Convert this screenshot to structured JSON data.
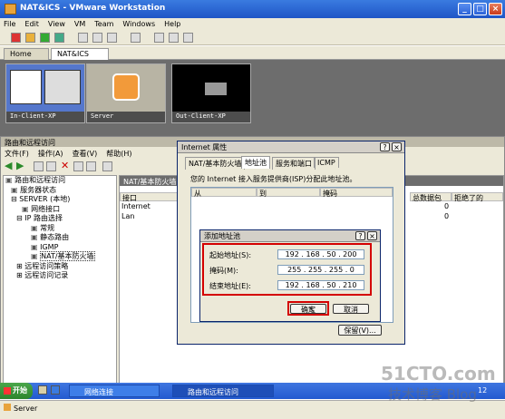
{
  "vmware": {
    "title": "NAT&ICS - VMware Workstation",
    "menu": [
      "File",
      "Edit",
      "View",
      "VM",
      "Team",
      "Windows",
      "Help"
    ],
    "tabs": [
      "Home",
      "NAT&ICS"
    ],
    "thumbs": [
      "In-Client-XP",
      "Server",
      "Out-Client-XP"
    ],
    "status": "Server"
  },
  "rras": {
    "title": "路由和远程访问",
    "menu": [
      "文件(F)",
      "操作(A)",
      "查看(V)",
      "帮助(H)"
    ],
    "tree": [
      "路由和远程访问",
      "服务器状态",
      "SERVER (本地)",
      "网络接口",
      "IP 路由选择",
      "常规",
      "静态路由",
      "IGMP",
      "NAT/基本防火墙",
      "远程访问策略",
      "远程访问记录"
    ],
    "pane_title": "NAT/基本防火墙",
    "cols": [
      "接口",
      "总数据包",
      "拒绝了的"
    ],
    "rows": [
      {
        "name": "Internet",
        "val": "0"
      },
      {
        "name": "Lan",
        "val": "0"
      }
    ]
  },
  "props": {
    "title": "Internet 属性",
    "tabs": [
      "NAT/基本防火墙",
      "地址池",
      "服务和端口",
      "ICMP"
    ],
    "desc": "您的 Internet 接入服务提供商(ISP)分配此地址池。",
    "cols": [
      "从",
      "到",
      "掩码"
    ],
    "reserve": "保留(V)..."
  },
  "addpool": {
    "title": "添加地址池",
    "start_label": "起始地址(S):",
    "start": "192 . 168 . 50 . 200",
    "mask_label": "掩码(M):",
    "mask": "255 . 255 . 255 . 0",
    "end_label": "结束地址(E):",
    "end": "192 . 168 . 50 . 210",
    "ok": "确定",
    "cancel": "取消"
  },
  "taskbar": {
    "start": "开始",
    "items": [
      "网络连接",
      "路由和远程访问"
    ],
    "time": "12"
  },
  "watermark": {
    "site": "51CTO.com",
    "blog": "技术博客 Blog"
  }
}
